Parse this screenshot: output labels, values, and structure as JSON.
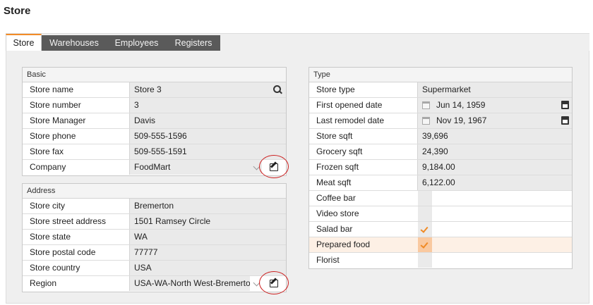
{
  "page": {
    "title": "Store"
  },
  "tabs": [
    {
      "label": "Store",
      "active": true
    },
    {
      "label": "Warehouses",
      "active": false
    },
    {
      "label": "Employees",
      "active": false
    },
    {
      "label": "Registers",
      "active": false
    }
  ],
  "basic": {
    "header": "Basic",
    "store_name": {
      "label": "Store name",
      "value": "Store 3",
      "icon": "search-icon"
    },
    "store_number": {
      "label": "Store number",
      "value": "3"
    },
    "store_manager": {
      "label": "Store Manager",
      "value": "Davis"
    },
    "store_phone": {
      "label": "Store phone",
      "value": "509-555-1596"
    },
    "store_fax": {
      "label": "Store fax",
      "value": "509-555-1591"
    },
    "company": {
      "label": "Company",
      "value": "FoodMart",
      "icon": "edit-icon"
    }
  },
  "address": {
    "header": "Address",
    "city": {
      "label": "Store city",
      "value": "Bremerton"
    },
    "street": {
      "label": "Store street address",
      "value": "1501 Ramsey Circle"
    },
    "state": {
      "label": "Store state",
      "value": "WA"
    },
    "postal": {
      "label": "Store postal code",
      "value": "77777"
    },
    "country": {
      "label": "Store country",
      "value": "USA"
    },
    "region": {
      "label": "Region",
      "value": "USA-WA-North West-Bremerton",
      "icon": "edit-icon"
    }
  },
  "type": {
    "header": "Type",
    "store_type": {
      "label": "Store type",
      "value": "Supermarket"
    },
    "first_opened": {
      "label": "First opened date",
      "value": "Jun 14, 1959",
      "icon": "calendar-icon"
    },
    "last_remodel": {
      "label": "Last remodel date",
      "value": "Nov 19, 1967",
      "icon": "calendar-icon"
    },
    "store_sqft": {
      "label": "Store sqft",
      "value": "39,696"
    },
    "grocery_sqft": {
      "label": "Grocery sqft",
      "value": "24,390"
    },
    "frozen_sqft": {
      "label": "Frozen sqft",
      "value": "9,184.00"
    },
    "meat_sqft": {
      "label": "Meat sqft",
      "value": "6,122.00"
    },
    "coffee_bar": {
      "label": "Coffee bar",
      "checked": false
    },
    "video_store": {
      "label": "Video store",
      "checked": false
    },
    "salad_bar": {
      "label": "Salad bar",
      "checked": true
    },
    "prepared_food": {
      "label": "Prepared food",
      "checked": true
    },
    "florist": {
      "label": "Florist",
      "checked": false
    }
  },
  "colors": {
    "accent": "#f28c28",
    "tab_inactive": "#5a5a5a",
    "highlight_circle": "#cc1f1f"
  }
}
